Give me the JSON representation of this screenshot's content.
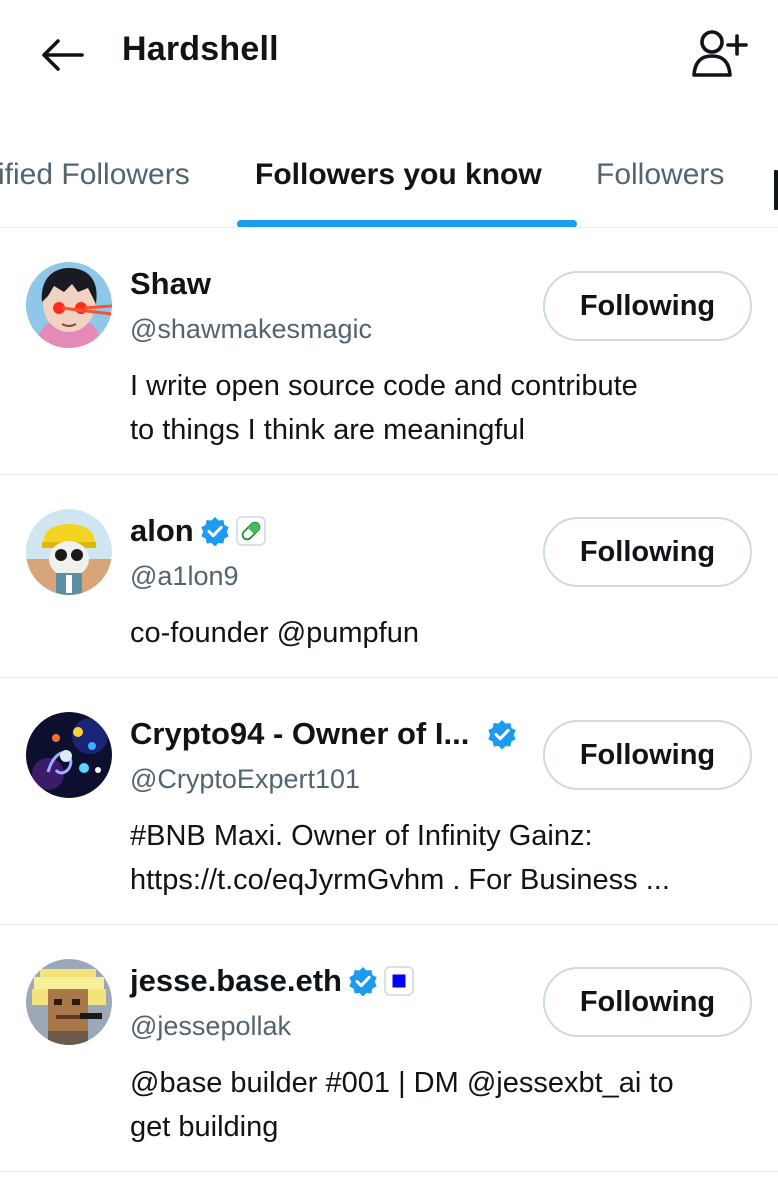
{
  "header": {
    "title": "Hardshell",
    "back_icon": "arrow-left-icon",
    "add_icon": "person-plus-icon"
  },
  "tabs": [
    {
      "label": "ified Followers",
      "active": false
    },
    {
      "label": "Followers you know",
      "active": true
    },
    {
      "label": "Followers",
      "active": false
    }
  ],
  "colors": {
    "accent": "#1d9bf0",
    "verified": "#1d9bf0",
    "muted": "#536471",
    "text": "#0f1419",
    "affiliate_blue": "#0000ff"
  },
  "followers": [
    {
      "name": "Shaw",
      "handle": "@shawmakesmagic",
      "bio_line1": "I write open source code and contribute",
      "bio_line2": "to things I think are meaningful",
      "button": "Following"
    },
    {
      "name": "alon",
      "handle": "@a1lon9",
      "bio_line1": "co-founder @pumpfun",
      "bio_line2": "",
      "button": "Following",
      "badges": [
        "verified-icon",
        "pill-icon"
      ]
    },
    {
      "name": "Crypto94 - Owner of I...",
      "handle": "@CryptoExpert101",
      "bio_line1": "#BNB Maxi. Owner of Infinity Gainz:",
      "bio_line2": "https://t.co/eqJyrmGvhm . For Business ...",
      "button": "Following",
      "badges": [
        "verified-icon"
      ]
    },
    {
      "name": "jesse.base.eth",
      "handle": "@jessepollak",
      "bio_line1": "@base builder #001 | DM @jessexbt_ai to",
      "bio_line2": "get building",
      "button": "Following",
      "badges": [
        "verified-icon",
        "square-affiliate-icon"
      ]
    }
  ]
}
